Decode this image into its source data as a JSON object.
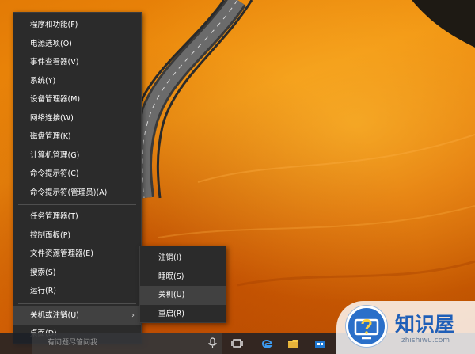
{
  "context_menu": {
    "group1": [
      "程序和功能(F)",
      "电源选项(O)",
      "事件查看器(V)",
      "系统(Y)",
      "设备管理器(M)",
      "网络连接(W)",
      "磁盘管理(K)",
      "计算机管理(G)",
      "命令提示符(C)",
      "命令提示符(管理员)(A)"
    ],
    "group2": [
      "任务管理器(T)",
      "控制面板(P)",
      "文件资源管理器(E)",
      "搜索(S)",
      "运行(R)"
    ],
    "shutdown_item": "关机或注销(U)",
    "desktop_item": "桌面(D)"
  },
  "shutdown_submenu": {
    "items": [
      "注销(I)",
      "睡眠(S)",
      "关机(U)",
      "重启(R)"
    ],
    "highlighted_index": 2
  },
  "taskbar": {
    "search_placeholder": "有问题尽管问我",
    "icons": [
      "microphone-icon",
      "task-view-icon",
      "edge-icon",
      "file-explorer-icon",
      "store-icon"
    ]
  },
  "watermark": {
    "title": "知识屋",
    "url": "zhishiwu.com"
  },
  "colors": {
    "menu_bg": "#2b2b2b",
    "menu_highlight": "#414141",
    "wallpaper_orange": "#f08d0c",
    "watermark_blue": "#1f5fb8"
  }
}
